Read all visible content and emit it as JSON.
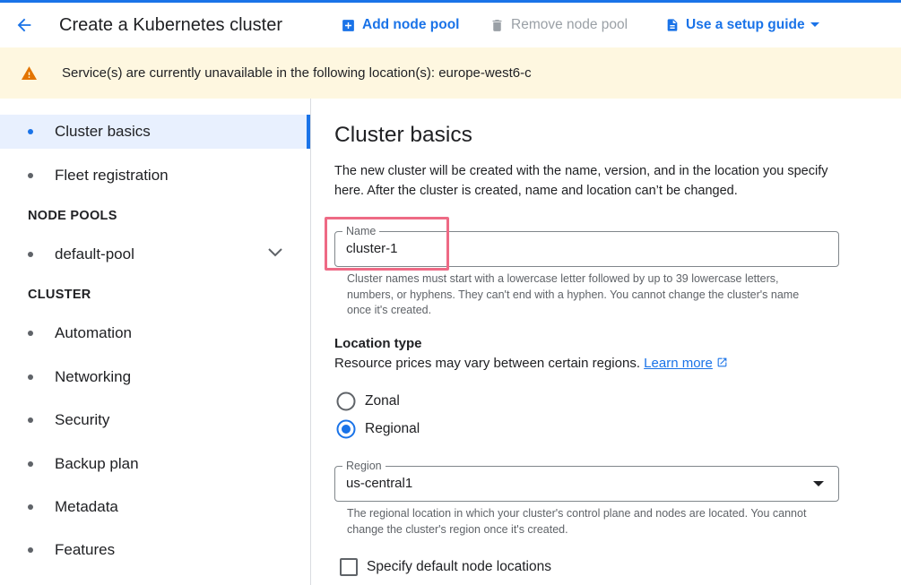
{
  "header": {
    "title": "Create a Kubernetes cluster",
    "add_node_pool": "Add node pool",
    "remove_node_pool": "Remove node pool",
    "setup_guide": "Use a setup guide"
  },
  "banner": {
    "message": "Service(s) are currently unavailable in the following location(s): europe-west6-c"
  },
  "sidebar": {
    "items": [
      {
        "label": "Cluster basics",
        "active": true
      },
      {
        "label": "Fleet registration"
      }
    ],
    "node_pools_heading": "NODE POOLS",
    "node_pools": [
      {
        "label": "default-pool"
      }
    ],
    "cluster_heading": "CLUSTER",
    "cluster_items": [
      {
        "label": "Automation"
      },
      {
        "label": "Networking"
      },
      {
        "label": "Security"
      },
      {
        "label": "Backup plan"
      },
      {
        "label": "Metadata"
      },
      {
        "label": "Features"
      }
    ]
  },
  "main": {
    "heading": "Cluster basics",
    "description": "The new cluster will be created with the name, version, and in the location you specify here. After the cluster is created, name and location can’t be changed.",
    "name_field": {
      "label": "Name",
      "value": "cluster-1",
      "hint": "Cluster names must start with a lowercase letter followed by up to 39 lowercase letters, numbers, or hyphens. They can't end with a hyphen. You cannot change the cluster's name once it's created."
    },
    "location_type": {
      "heading": "Location type",
      "description": "Resource prices may vary between certain regions.",
      "learn_more": "Learn more",
      "options": [
        {
          "label": "Zonal",
          "selected": false
        },
        {
          "label": "Regional",
          "selected": true
        }
      ]
    },
    "region_field": {
      "label": "Region",
      "value": "us-central1",
      "hint": "The regional location in which your cluster's control plane and nodes are located. You cannot change the cluster's region once it's created."
    },
    "default_node_locations": {
      "label": "Specify default node locations",
      "checked": false
    }
  },
  "colors": {
    "accent": "#1a73e8",
    "banner_bg": "#fef7e0",
    "warning": "#e37400",
    "highlight": "#ee6a85"
  }
}
